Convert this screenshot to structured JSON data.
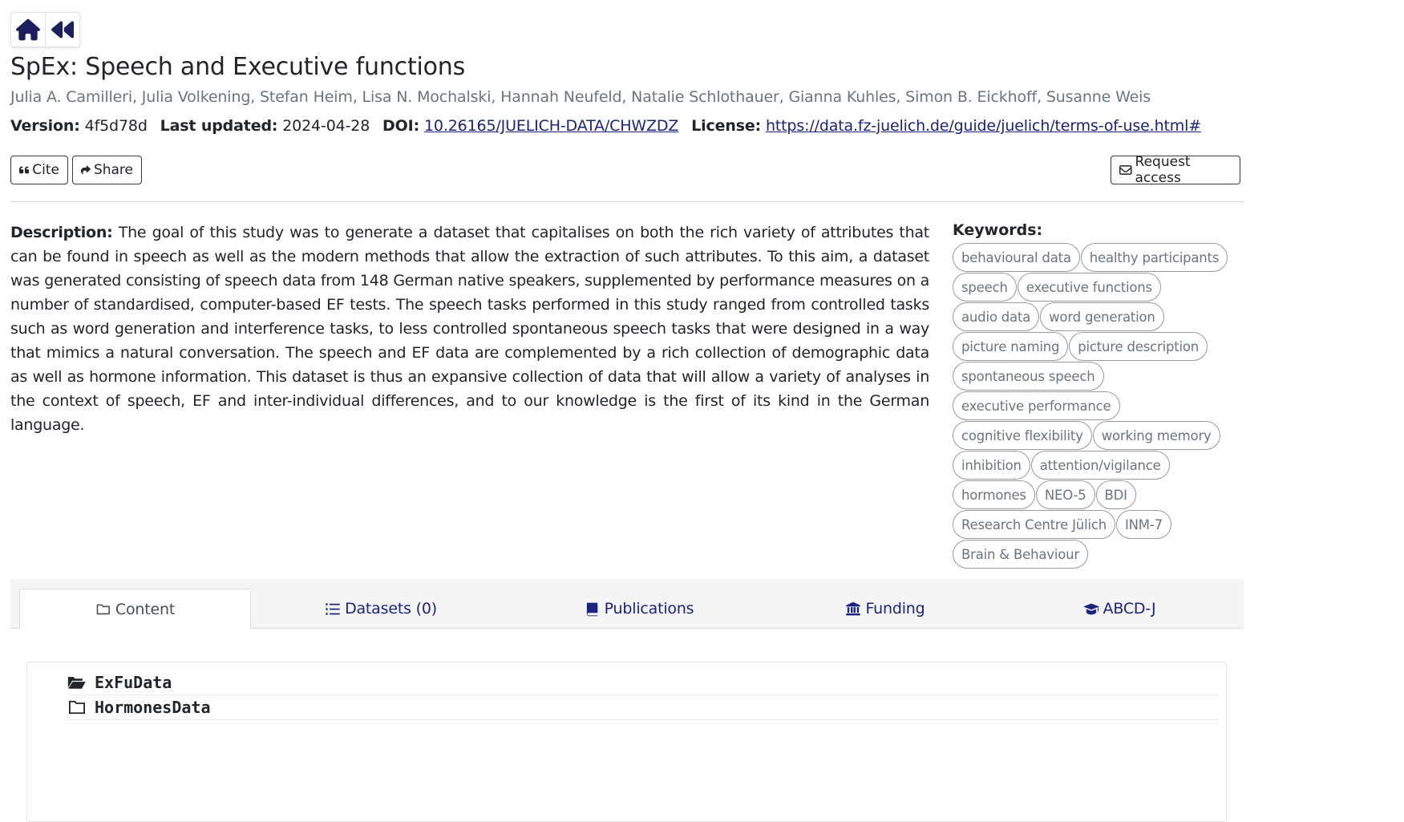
{
  "title": "SpEx: Speech and Executive functions",
  "authors": "Julia A. Camilleri, Julia Volkening, Stefan Heim, Lisa N. Mochalski, Hannah Neufeld, Natalie Schlothauer, Gianna Kuhles, Simon B. Eickhoff, Susanne Weis",
  "meta": {
    "version_label": "Version:",
    "version": "4f5d78d",
    "updated_label": "Last updated:",
    "updated": "2024-04-28",
    "doi_label": "DOI:",
    "doi": "10.26165/JUELICH-DATA/CHWZDZ",
    "license_label": "License:",
    "license": "https://data.fz-juelich.de/guide/juelich/terms-of-use.html#"
  },
  "buttons": {
    "cite": "Cite",
    "share": "Share",
    "request_access": "Request access"
  },
  "description": {
    "label": "Description:",
    "text": "The goal of this study was to generate a dataset that capitalises on both the rich variety of attributes that can be found in speech as well as the modern methods that allow the extraction of such attributes. To this aim, a dataset was generated consisting of speech data from 148 German native speakers, supplemented by performance measures on a number of standardised, computer-based EF tests. The speech tasks performed in this study ranged from controlled tasks such as word generation and interference tasks, to less controlled spontaneous speech tasks that were designed in a way that mimics a natural conversation. The speech and EF data are complemented by a rich collection of demographic data as well as hormone information. This dataset is thus an expansive collection of data that will allow a variety of analyses in the context of speech, EF and inter-individual differences, and to our knowledge is the first of its kind in the German language."
  },
  "keywords": {
    "label": "Keywords:",
    "items": [
      "behavioural data",
      "healthy participants",
      "speech",
      "executive functions",
      "audio data",
      "word generation",
      "picture naming",
      "picture description",
      "spontaneous speech",
      "executive performance",
      "cognitive flexibility",
      "working memory",
      "inhibition",
      "attention/vigilance",
      "hormones",
      "NEO-5",
      "BDI",
      "Research Centre Jülich",
      "INM-7",
      "Brain & Behaviour"
    ]
  },
  "tabs": [
    {
      "label": "Content",
      "icon": "folder-icon"
    },
    {
      "label": "Datasets (0)",
      "icon": "list-icon"
    },
    {
      "label": "Publications",
      "icon": "book-icon"
    },
    {
      "label": "Funding",
      "icon": "bank-icon"
    },
    {
      "label": "ABCD-J",
      "icon": "graduation-cap-icon"
    }
  ],
  "files": [
    {
      "name": "ExFuData",
      "icon": "folder-open-icon"
    },
    {
      "name": "HormonesData",
      "icon": "folder-icon"
    }
  ],
  "colors": {
    "link": "#1a237e",
    "icon": "#1b1f5f",
    "muted": "#6c757d"
  }
}
